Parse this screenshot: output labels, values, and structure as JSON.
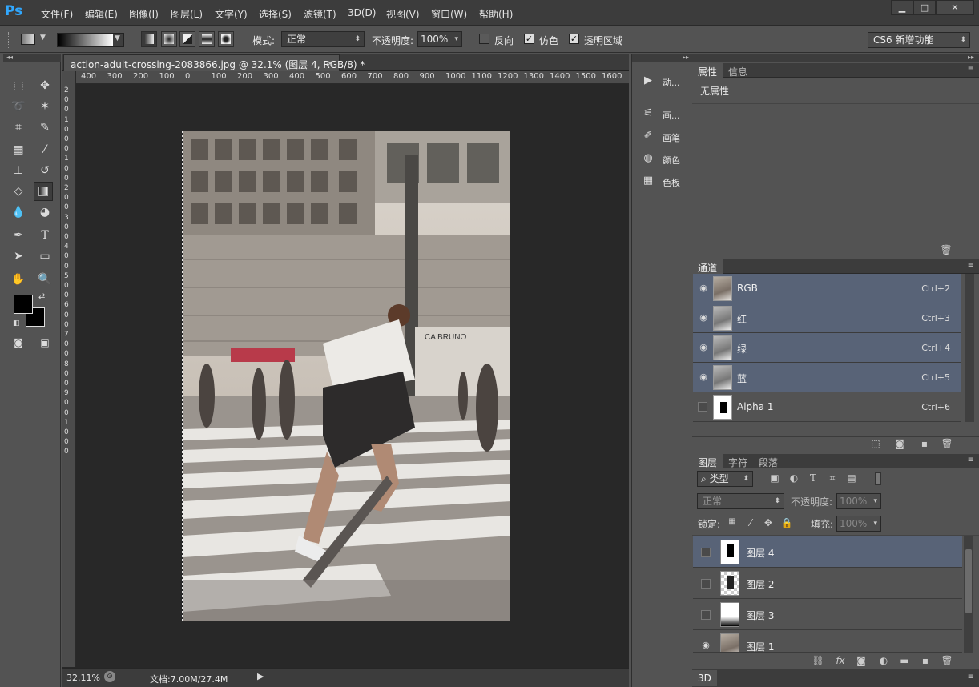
{
  "app": {
    "logo": "Ps"
  },
  "menu": [
    "文件(F)",
    "编辑(E)",
    "图像(I)",
    "图层(L)",
    "文字(Y)",
    "选择(S)",
    "滤镜(T)",
    "3D(D)",
    "视图(V)",
    "窗口(W)",
    "帮助(H)"
  ],
  "window_controls": {
    "minimize": "▁",
    "maximize": "□",
    "close": "✕"
  },
  "options": {
    "mode_label": "模式:",
    "mode_value": "正常",
    "opacity_label": "不透明度:",
    "opacity_value": "100%",
    "reverse_label": "反向",
    "dither_label": "仿色",
    "transparency_label": "透明区域",
    "workspace": "CS6 新增功能"
  },
  "document": {
    "tab_title": "action-adult-crossing-2083866.jpg @ 32.1% (图层 4, RGB/8) *",
    "zoom": "32.11%",
    "doc_info": "文档:7.00M/27.4M"
  },
  "ruler": {
    "h_ticks": [
      "400",
      "300",
      "200",
      "100",
      "0",
      "100",
      "200",
      "300",
      "400",
      "500",
      "600",
      "700",
      "800",
      "900",
      "1000",
      "1100",
      "1200",
      "1300",
      "1400",
      "1500",
      "1600"
    ],
    "v_ticks": [
      "2",
      "0",
      "0",
      "1",
      "0",
      "0",
      "0",
      "1",
      "0",
      "0",
      "2",
      "0",
      "0",
      "3",
      "0",
      "0",
      "4",
      "0",
      "0",
      "5",
      "0",
      "0",
      "6",
      "0",
      "0",
      "7",
      "0",
      "0",
      "8",
      "0",
      "0",
      "9",
      "0",
      "0",
      "1",
      "0",
      "0",
      "0"
    ]
  },
  "canvas_sign": "CA BRUNO",
  "icon_strip": {
    "actions": "动...",
    "brush_presets": "画...",
    "brush": "画笔",
    "color": "颜色",
    "swatches": "色板"
  },
  "properties_panel": {
    "tabs": [
      "属性",
      "信息"
    ],
    "content": "无属性"
  },
  "channels_panel": {
    "tab": "通道",
    "channels": [
      {
        "name": "RGB",
        "shortcut": "Ctrl+2",
        "visible": true
      },
      {
        "name": "红",
        "shortcut": "Ctrl+3",
        "visible": true
      },
      {
        "name": "绿",
        "shortcut": "Ctrl+4",
        "visible": true
      },
      {
        "name": "蓝",
        "shortcut": "Ctrl+5",
        "visible": true
      },
      {
        "name": "Alpha 1",
        "shortcut": "Ctrl+6",
        "visible": false
      }
    ]
  },
  "layers_panel": {
    "tabs": [
      "图层",
      "字符",
      "段落"
    ],
    "filter_type": "类型",
    "blend_mode": "正常",
    "opacity_label": "不透明度:",
    "opacity_value": "100%",
    "lock_label": "锁定:",
    "fill_label": "填充:",
    "fill_value": "100%",
    "layers": [
      {
        "name": "图层 4",
        "visible": false,
        "selected": true
      },
      {
        "name": "图层 2",
        "visible": false,
        "selected": false
      },
      {
        "name": "图层 3",
        "visible": false,
        "selected": false
      },
      {
        "name": "图层 1",
        "visible": true,
        "selected": false
      }
    ]
  },
  "bottom_tab": "3D"
}
